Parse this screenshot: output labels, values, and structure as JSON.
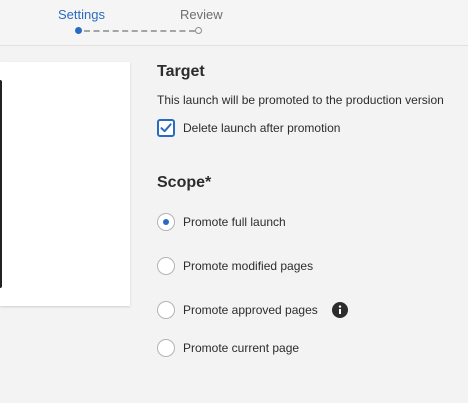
{
  "steps": [
    {
      "label": "Settings",
      "state": "current"
    },
    {
      "label": "Review",
      "state": "pending"
    }
  ],
  "target": {
    "title": "Target",
    "description": "This launch will be promoted to the production version",
    "delete_checkbox": {
      "label": "Delete launch after promotion",
      "checked": true
    }
  },
  "scope": {
    "title": "Scope*",
    "options": [
      {
        "label": "Promote full launch",
        "selected": true
      },
      {
        "label": "Promote modified pages",
        "selected": false
      },
      {
        "label": "Promote approved pages",
        "selected": false,
        "info_icon": "info-icon"
      },
      {
        "label": "Promote current page",
        "selected": false
      }
    ]
  },
  "colors": {
    "accent": "#2a6bc2",
    "background": "#f3f3f3"
  }
}
